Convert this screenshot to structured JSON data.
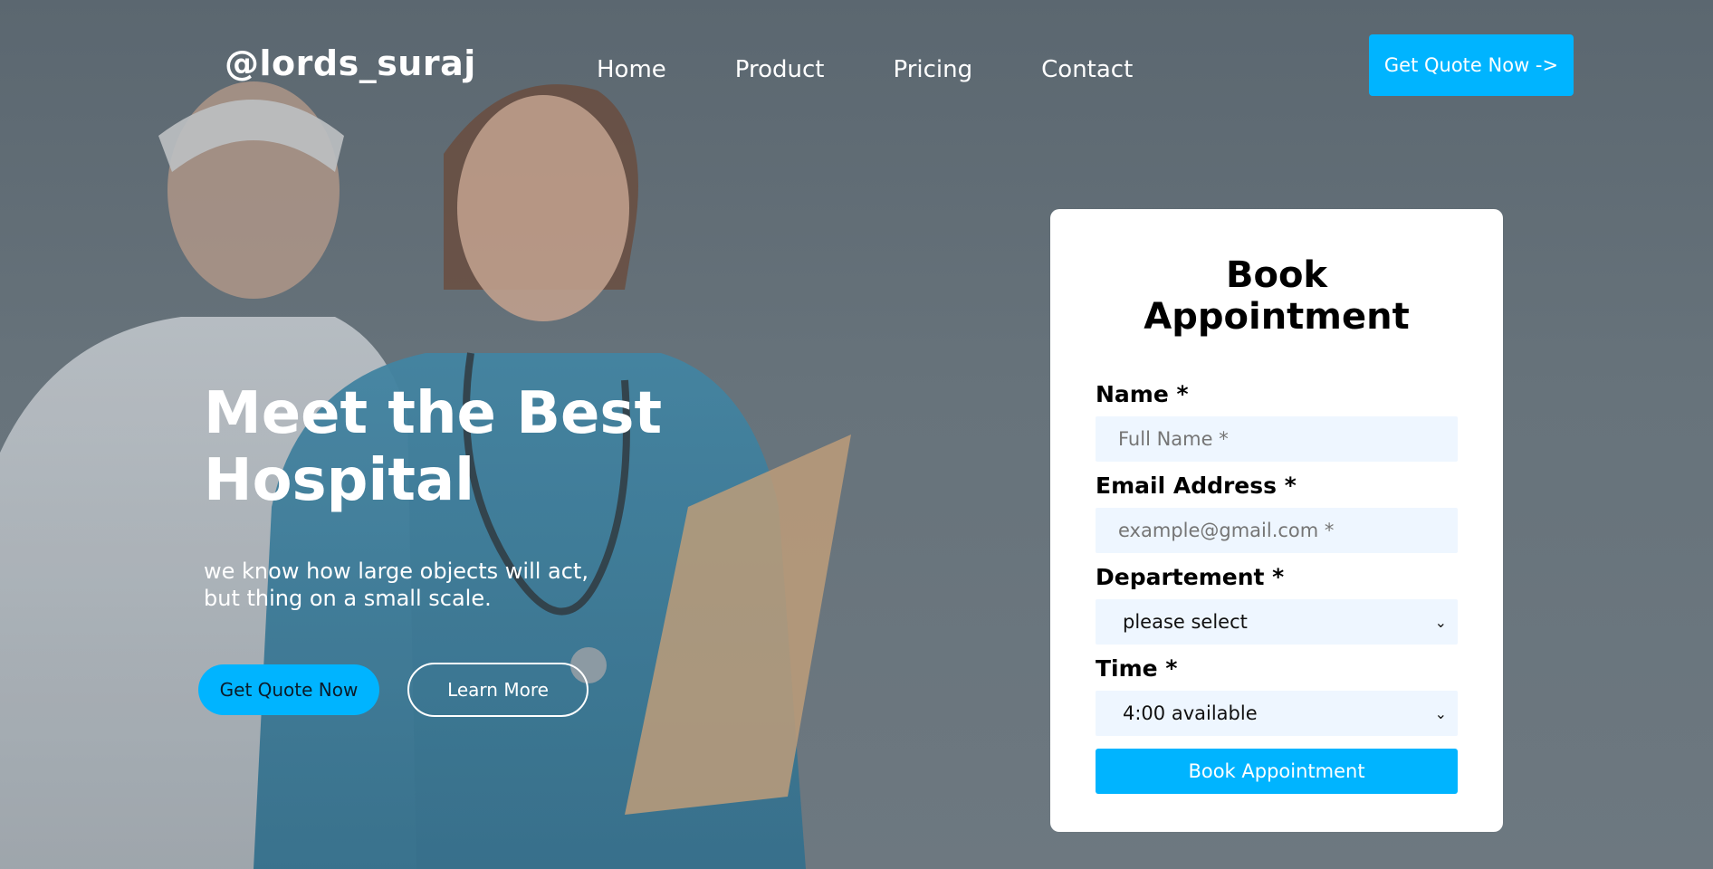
{
  "header": {
    "logo": "@lords_suraj",
    "nav": [
      {
        "label": "Home"
      },
      {
        "label": "Product"
      },
      {
        "label": "Pricing"
      },
      {
        "label": "Contact"
      }
    ],
    "cta_label": "Get Quote Now ->"
  },
  "hero": {
    "title_line1": "Meet the Best",
    "title_line2": "Hospital",
    "subtitle_line1": "we know how large objects will act,",
    "subtitle_line2": "but thing on a small scale.",
    "primary_button": "Get Quote Now",
    "secondary_button": "Learn More"
  },
  "booking": {
    "title": "Book Appointment",
    "name_label": "Name *",
    "name_placeholder": "Full Name *",
    "email_label": "Email Address *",
    "email_placeholder": "example@gmail.com *",
    "department_label": "Departement *",
    "department_value": "please select",
    "time_label": "Time *",
    "time_value": "4:00 available",
    "submit_label": "Book Appointment"
  },
  "colors": {
    "accent": "#00b4ff",
    "field_bg": "#eef6ff",
    "overlay": "#5b6770"
  }
}
